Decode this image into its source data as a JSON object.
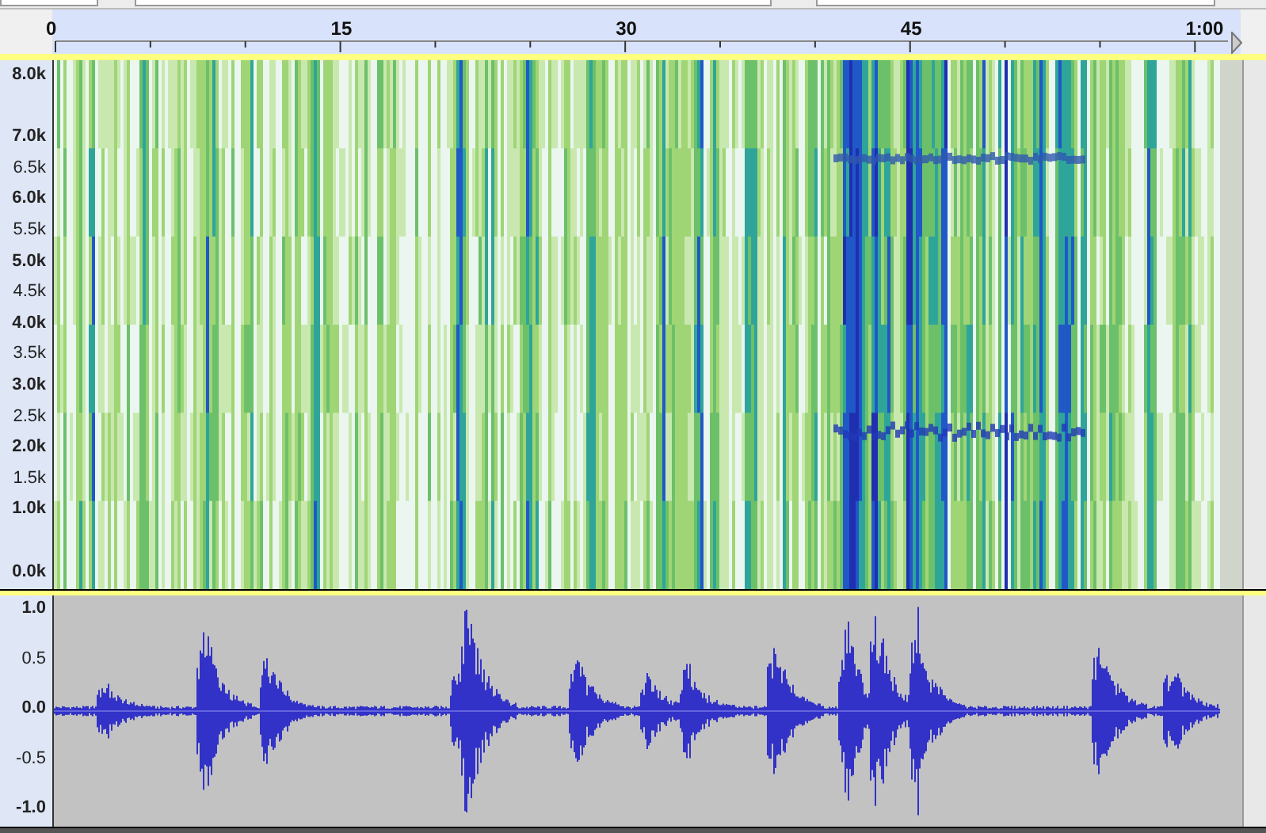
{
  "ruler": {
    "labels": [
      "0",
      "15",
      "30",
      "45",
      "1:00"
    ]
  },
  "spectrogram_axis": {
    "labels": [
      {
        "text": "8.0k",
        "major": true
      },
      {
        "text": "7.0k",
        "major": true
      },
      {
        "text": "6.5k",
        "major": false
      },
      {
        "text": "6.0k",
        "major": true
      },
      {
        "text": "5.5k",
        "major": false
      },
      {
        "text": "5.0k",
        "major": true
      },
      {
        "text": "4.5k",
        "major": false
      },
      {
        "text": "4.0k",
        "major": true
      },
      {
        "text": "3.5k",
        "major": false
      },
      {
        "text": "3.0k",
        "major": true
      },
      {
        "text": "2.5k",
        "major": false
      },
      {
        "text": "2.0k",
        "major": true
      },
      {
        "text": "1.5k",
        "major": false
      },
      {
        "text": "1.0k",
        "major": true
      },
      {
        "text": "0.0k",
        "major": true
      }
    ]
  },
  "waveform_axis": {
    "labels": [
      {
        "text": "1.0",
        "major": true
      },
      {
        "text": "0.5",
        "major": false
      },
      {
        "text": "0.0",
        "major": true
      },
      {
        "text": "-0.5",
        "major": false
      },
      {
        "text": "-1.0",
        "major": true
      }
    ]
  }
}
